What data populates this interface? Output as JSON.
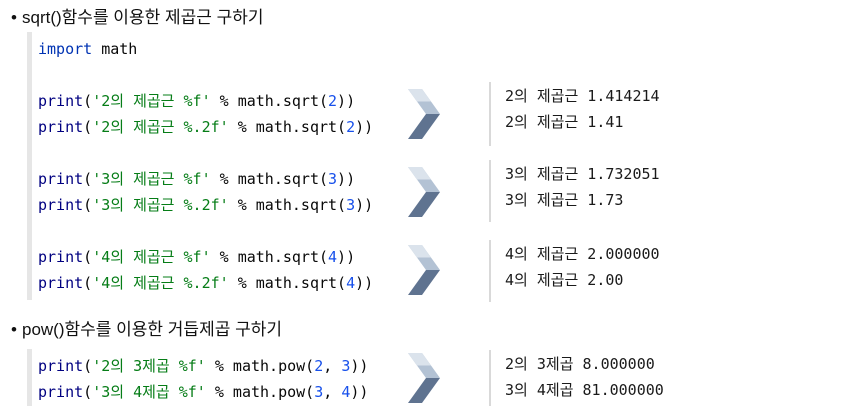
{
  "colors": {
    "arrow_top": "#b3c2d4",
    "arrow_highlight": "#dbe3ec",
    "arrow_bottom": "#5f7390",
    "code_bar": "#e6e6e6",
    "output_rule": "#d9d9d9"
  },
  "sections": [
    {
      "bullet": "•",
      "heading": "sqrt()함수를 이용한 제곱근 구하기",
      "code": [
        [
          {
            "text": "import",
            "color": "#0033b3"
          },
          {
            "text": " math",
            "color": "#080808"
          }
        ],
        [],
        [
          {
            "text": "print",
            "color": "#000080"
          },
          {
            "text": "(",
            "color": "#080808"
          },
          {
            "text": "'2의 제곱근 %f'",
            "color": "#067d17"
          },
          {
            "text": " % math.sqrt(",
            "color": "#080808"
          },
          {
            "text": "2",
            "color": "#1750eb"
          },
          {
            "text": "))",
            "color": "#080808"
          }
        ],
        [
          {
            "text": "print",
            "color": "#000080"
          },
          {
            "text": "(",
            "color": "#080808"
          },
          {
            "text": "'2의 제곱근 %.2f'",
            "color": "#067d17"
          },
          {
            "text": " % math.sqrt(",
            "color": "#080808"
          },
          {
            "text": "2",
            "color": "#1750eb"
          },
          {
            "text": "))",
            "color": "#080808"
          }
        ],
        [],
        [
          {
            "text": "print",
            "color": "#000080"
          },
          {
            "text": "(",
            "color": "#080808"
          },
          {
            "text": "'3의 제곱근 %f'",
            "color": "#067d17"
          },
          {
            "text": " % math.sqrt(",
            "color": "#080808"
          },
          {
            "text": "3",
            "color": "#1750eb"
          },
          {
            "text": "))",
            "color": "#080808"
          }
        ],
        [
          {
            "text": "print",
            "color": "#000080"
          },
          {
            "text": "(",
            "color": "#080808"
          },
          {
            "text": "'3의 제곱근 %.2f'",
            "color": "#067d17"
          },
          {
            "text": " % math.sqrt(",
            "color": "#080808"
          },
          {
            "text": "3",
            "color": "#1750eb"
          },
          {
            "text": "))",
            "color": "#080808"
          }
        ],
        [],
        [
          {
            "text": "print",
            "color": "#000080"
          },
          {
            "text": "(",
            "color": "#080808"
          },
          {
            "text": "'4의 제곱근 %f'",
            "color": "#067d17"
          },
          {
            "text": " % math.sqrt(",
            "color": "#080808"
          },
          {
            "text": "4",
            "color": "#1750eb"
          },
          {
            "text": "))",
            "color": "#080808"
          }
        ],
        [
          {
            "text": "print",
            "color": "#000080"
          },
          {
            "text": "(",
            "color": "#080808"
          },
          {
            "text": "'4의 제곱근 %.2f'",
            "color": "#067d17"
          },
          {
            "text": " % math.sqrt(",
            "color": "#080808"
          },
          {
            "text": "4",
            "color": "#1750eb"
          },
          {
            "text": "))",
            "color": "#080808"
          }
        ]
      ],
      "outputs": [
        [
          "2의 제곱근 1.414214",
          "2의 제곱근 1.41"
        ],
        [
          "3의 제곱근 1.732051",
          "3의 제곱근 1.73"
        ],
        [
          "4의 제곱근 2.000000",
          "4의 제곱근 2.00"
        ]
      ]
    },
    {
      "bullet": "•",
      "heading": "pow()함수를 이용한 거듭제곱 구하기",
      "code": [
        [
          {
            "text": "print",
            "color": "#000080"
          },
          {
            "text": "(",
            "color": "#080808"
          },
          {
            "text": "'2의 3제곱 %f'",
            "color": "#067d17"
          },
          {
            "text": " % math.pow(",
            "color": "#080808"
          },
          {
            "text": "2",
            "color": "#1750eb"
          },
          {
            "text": ", ",
            "color": "#080808"
          },
          {
            "text": "3",
            "color": "#1750eb"
          },
          {
            "text": "))",
            "color": "#080808"
          }
        ],
        [
          {
            "text": "print",
            "color": "#000080"
          },
          {
            "text": "(",
            "color": "#080808"
          },
          {
            "text": "'3의 4제곱 %f'",
            "color": "#067d17"
          },
          {
            "text": " % math.pow(",
            "color": "#080808"
          },
          {
            "text": "3",
            "color": "#1750eb"
          },
          {
            "text": ", ",
            "color": "#080808"
          },
          {
            "text": "4",
            "color": "#1750eb"
          },
          {
            "text": "))",
            "color": "#080808"
          }
        ]
      ],
      "outputs": [
        [
          "2의 3제곱 8.000000",
          "3의 4제곱 81.000000"
        ]
      ]
    }
  ]
}
